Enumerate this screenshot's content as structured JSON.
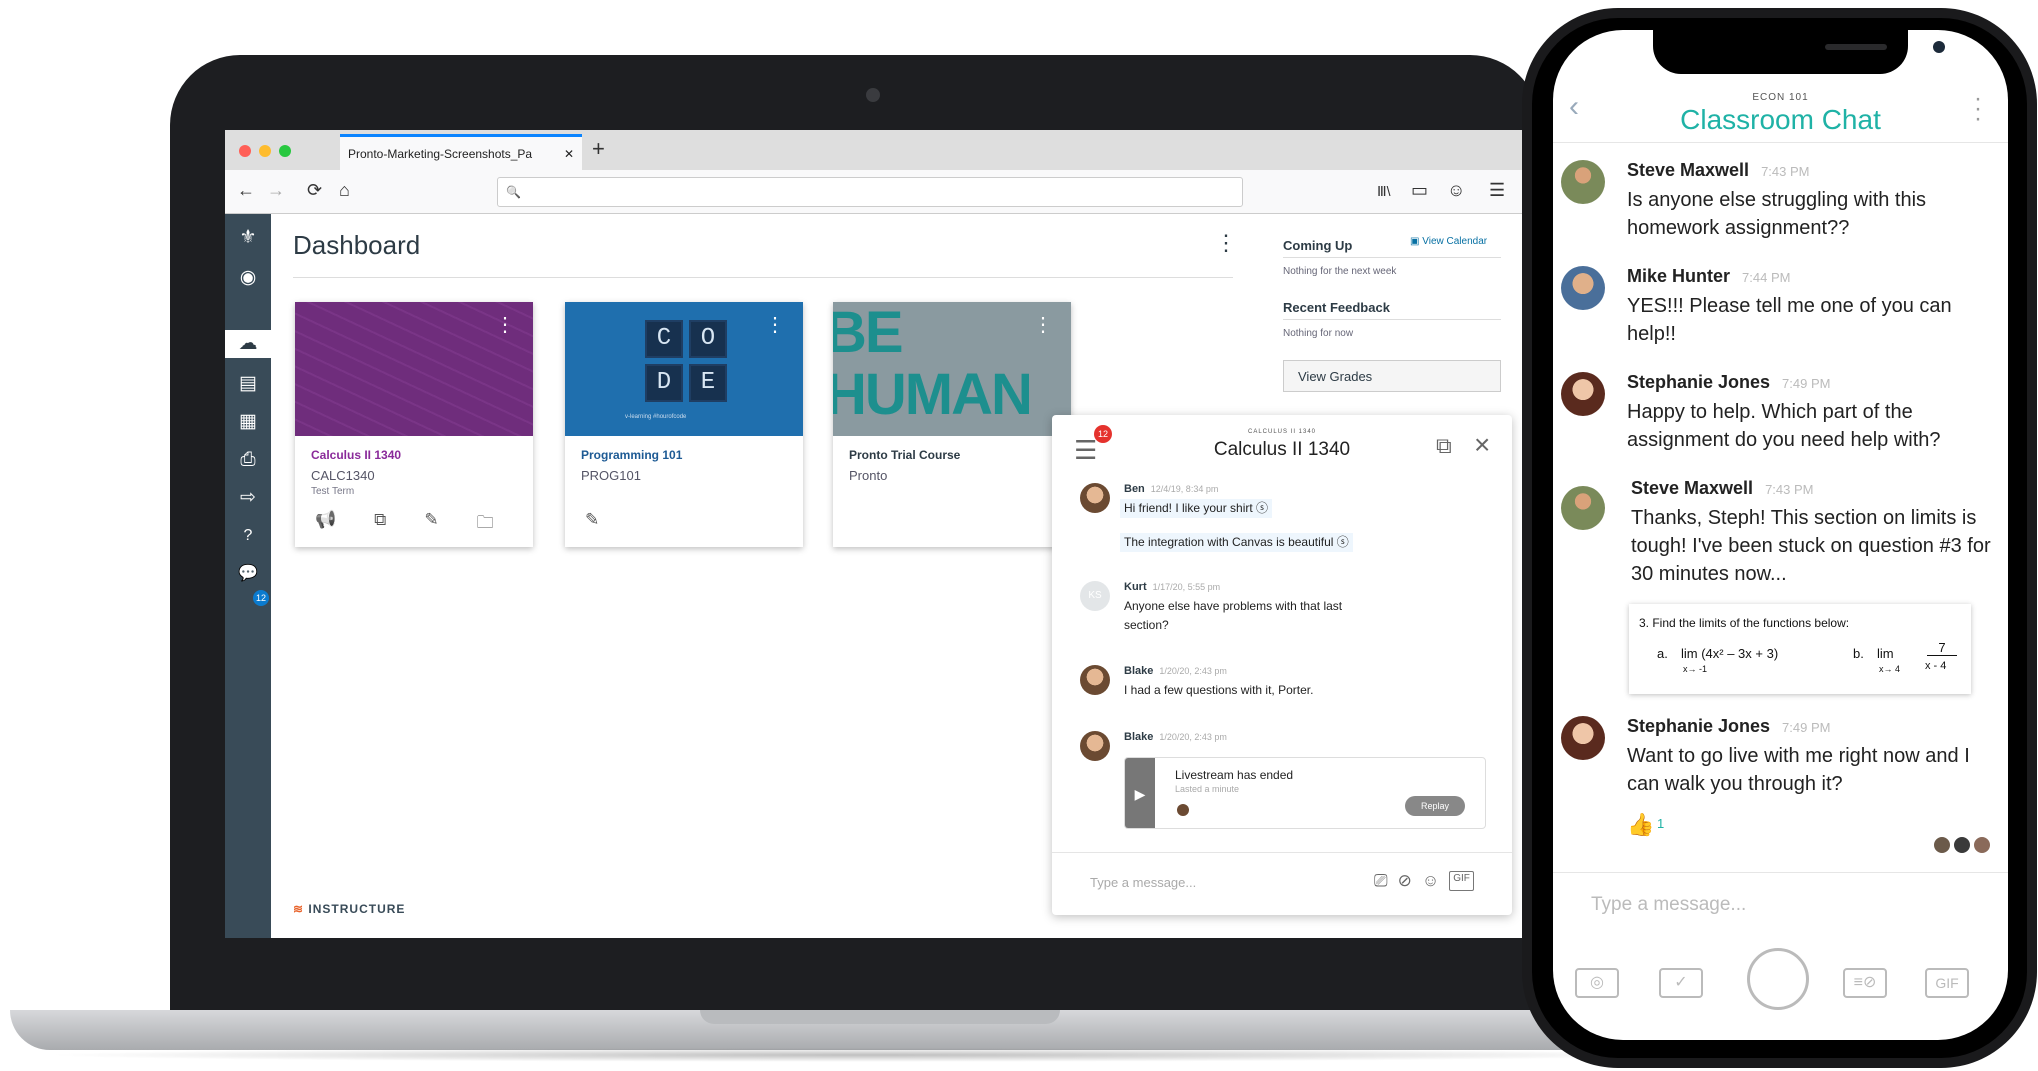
{
  "browser": {
    "tab_title": "Pronto-Marketing-Screenshots_Pa",
    "tab_close": "✕",
    "new_tab": "+",
    "nav": {
      "back": "←",
      "forward": "→",
      "reload": "⟳",
      "home": "⌂",
      "search_icon": "🔍"
    },
    "toolbar": {
      "library": "Ⅲ\\",
      "reader": "▭",
      "account": "☺",
      "menu": "☰"
    }
  },
  "colors": {
    "accent_teal": "#1fb2a6",
    "canvas_sidebar": "#394b58",
    "link_blue": "#0770a3",
    "badge_red": "#e5322d"
  },
  "sidebar": {
    "items": [
      {
        "icon": "canvas-logo-icon",
        "glyph": "⚜"
      },
      {
        "icon": "account-icon",
        "glyph": "◉"
      },
      {
        "icon": "dashboard-icon",
        "glyph": "☁"
      },
      {
        "icon": "courses-icon",
        "glyph": "▤"
      },
      {
        "icon": "calendar-icon",
        "glyph": "▦"
      },
      {
        "icon": "inbox-icon",
        "glyph": "⎙"
      },
      {
        "icon": "commons-icon",
        "glyph": "⇨"
      },
      {
        "icon": "help-icon",
        "glyph": "?"
      },
      {
        "icon": "pronto-chat-icon",
        "glyph": "💬"
      }
    ],
    "chat_badge": "12",
    "collapse": "→|"
  },
  "dashboard": {
    "title": "Dashboard",
    "more": "⋮",
    "cards": [
      {
        "title": "Calculus II 1340",
        "code": "CALC1340",
        "term": "Test Term",
        "title_color": "#8a2a9a",
        "image_color": "#6f2d7c",
        "icons": [
          "📢",
          "⧉",
          "✎",
          "🗀"
        ]
      },
      {
        "title": "Programming 101",
        "code": "PROG101",
        "term": "",
        "title_color": "#1d5a94",
        "image_color": "#1f6fae",
        "icons": [
          "✎"
        ],
        "code_letters": [
          "C",
          "O",
          "D",
          "E"
        ],
        "code_sub": "v-learning    #hourofcode"
      },
      {
        "title": "Pronto Trial Course",
        "code": "Pronto",
        "term": "",
        "title_color": "#2d3b45",
        "image_color": "#8a9aa0",
        "image_text": [
          "BE",
          "HUMAN"
        ],
        "icons": []
      }
    ],
    "instructure": "INSTRUCTURE",
    "instructure_mark": "≋"
  },
  "right_panel": {
    "coming_up": "Coming Up",
    "view_calendar": "View Calendar",
    "nothing_week": "Nothing for the next week",
    "recent_feedback": "Recent Feedback",
    "nothing_now": "Nothing for now",
    "view_grades": "View Grades"
  },
  "course_chat": {
    "badge": "12",
    "caption": "CALCULUS II 1340",
    "title": "Calculus II 1340",
    "messages": [
      {
        "name": "Ben",
        "time": "12/4/19, 8:34 pm",
        "lines": [
          "Hi friend! I like your shirt ⓢ",
          "The integration with Canvas is beautiful ⓢ"
        ]
      },
      {
        "name": "Kurt",
        "time": "1/17/20, 5:55 pm",
        "initials": "KS",
        "lines": [
          "Anyone else have problems with that last",
          "section?"
        ]
      },
      {
        "name": "Blake",
        "time": "1/20/20, 2:43 pm",
        "lines": [
          "I had a few questions with it, Porter."
        ]
      },
      {
        "name": "Blake",
        "time": "1/20/20, 2:43 pm",
        "lines": []
      }
    ],
    "livestream": {
      "title": "Livestream has ended",
      "sub": "Lasted a minute",
      "replay": "Replay"
    },
    "input_placeholder": "Type a message...",
    "gif": "GIF"
  },
  "phone": {
    "caption": "ECON 101",
    "title": "Classroom Chat",
    "back": "‹",
    "messages": [
      {
        "name": "Steve Maxwell",
        "time": "7:43 PM",
        "text": "Is anyone else struggling with this homework assignment??"
      },
      {
        "name": "Mike Hunter",
        "time": "7:44 PM",
        "text": "YES!!! Please tell me one of you can help!!"
      },
      {
        "name": "Stephanie Jones",
        "time": "7:49 PM",
        "text": "Happy to help. Which part of the assignment do you need help with?"
      },
      {
        "name": "Steve Maxwell",
        "time": "7:43 PM",
        "text": "Thanks, Steph! This section on limits is tough! I've been stuck on question #3 for 30 minutes now..."
      },
      {
        "name": "Stephanie Jones",
        "time": "7:49 PM",
        "text": "Want to go live with me right now and I can walk you through it?"
      }
    ],
    "math": {
      "q": "3.  Find the limits of the functions below:",
      "a_label": "a.",
      "a_expr": "lim (4x² – 3x + 3)",
      "a_sub": "x→ -1",
      "b_label": "b.",
      "b_expr": "lim",
      "b_num": "7",
      "b_den": "x - 4",
      "b_sub": "x→ 4"
    },
    "reaction": {
      "emoji": "👍",
      "count": "1"
    },
    "input_placeholder": "Type a message...",
    "tools": {
      "camera": "◎",
      "check": "✓",
      "attach": "≡⊘",
      "gif": "GIF"
    }
  }
}
